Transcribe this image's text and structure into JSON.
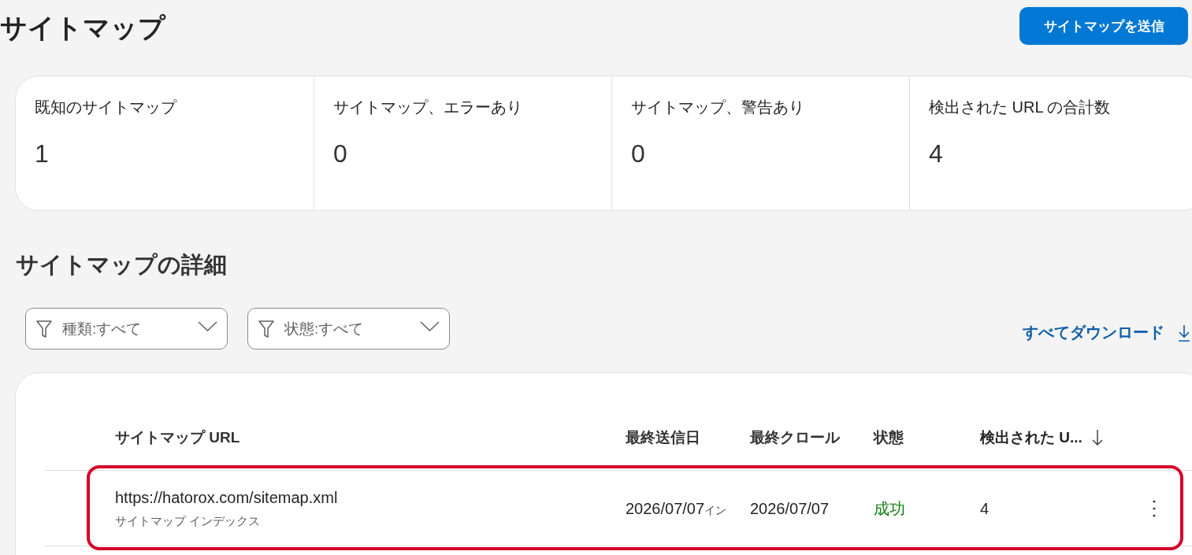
{
  "page": {
    "title": "サイトマップ",
    "submit_button": "サイトマップを送信"
  },
  "summary": [
    {
      "label": "既知のサイトマップ",
      "value": "1"
    },
    {
      "label": "サイトマップ、エラーあり",
      "value": "0"
    },
    {
      "label": "サイトマップ、警告あり",
      "value": "0"
    },
    {
      "label": "検出された URL の合計数",
      "value": "4"
    }
  ],
  "details": {
    "title": "サイトマップの詳細",
    "filters": [
      {
        "label": "種類:すべて"
      },
      {
        "label": "状態:すべて"
      }
    ],
    "download_link": "すべてダウンロード"
  },
  "table": {
    "columns": [
      {
        "label": "サイトマップ URL",
        "sorted": false
      },
      {
        "label": "最終送信日",
        "sorted": false
      },
      {
        "label": "最終クロール",
        "sorted": false
      },
      {
        "label": "状態",
        "sorted": false
      },
      {
        "label": "検出された U...",
        "sorted": true
      }
    ],
    "rows": [
      {
        "url": "https://hatorox.com/sitemap.xml",
        "type": "サイトマップ インデックス",
        "last_submitted": "2026/07/07",
        "last_submitted_overflow": "イン",
        "last_crawled": "2026/07/07",
        "status": "成功",
        "status_ok": true,
        "discovered_urls": "4",
        "highlighted": true
      }
    ]
  }
}
